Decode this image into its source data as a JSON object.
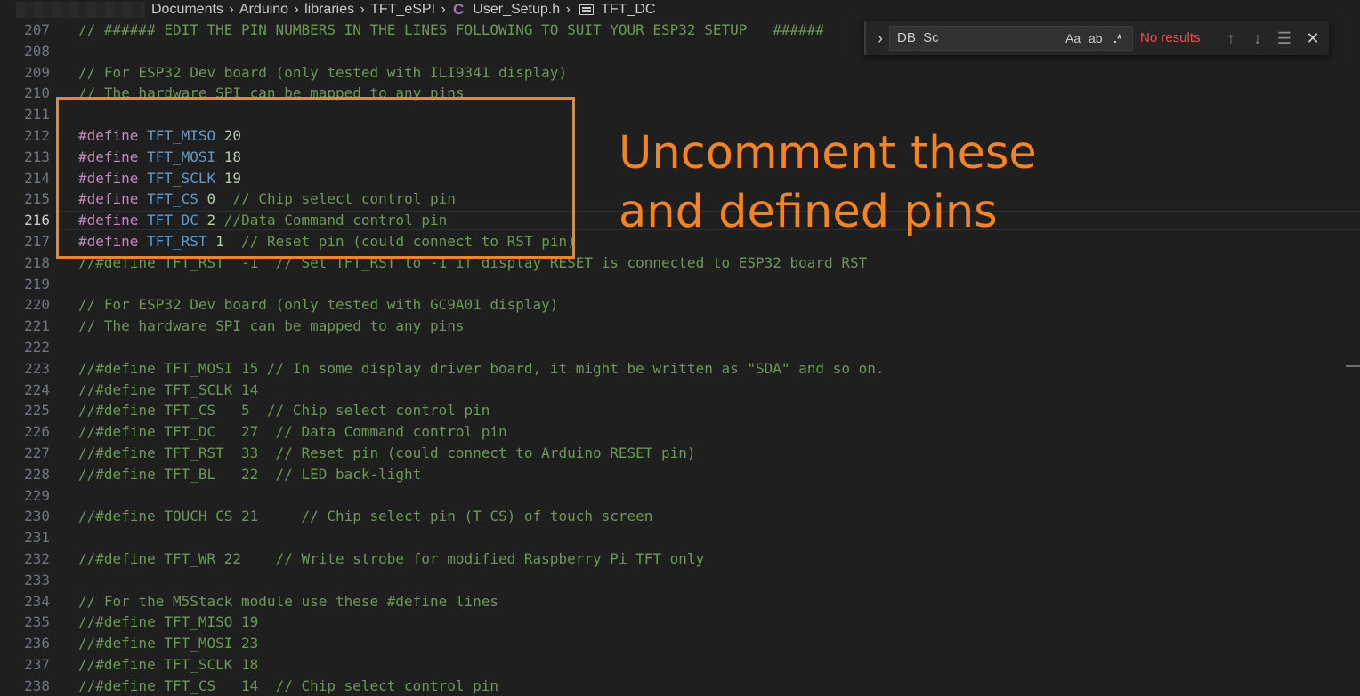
{
  "breadcrumb": {
    "items": [
      "Documents",
      "Arduino",
      "libraries",
      "TFT_eSPI",
      "User_Setup.h",
      "TFT_DC"
    ],
    "file_icon": "C"
  },
  "find": {
    "query": "DB_Sc",
    "match_case": "Aa",
    "whole_word": "ab",
    "regex": ".*",
    "status": "No results"
  },
  "annotation": {
    "line1": "Uncomment these",
    "line2": "and defined pins",
    "color": "#f5841f"
  },
  "editor": {
    "active_line": 216,
    "lines": [
      {
        "n": "207",
        "tokens": [
          {
            "t": "cm",
            "v": "// ###### EDIT THE PIN NUMBERS IN THE LINES FOLLOWING TO SUIT YOUR ESP32 SETUP   ######"
          }
        ]
      },
      {
        "n": "208",
        "tokens": []
      },
      {
        "n": "209",
        "tokens": [
          {
            "t": "cm",
            "v": "// For ESP32 Dev board (only tested with ILI9341 display)"
          }
        ]
      },
      {
        "n": "210",
        "tokens": [
          {
            "t": "cm",
            "v": "// The hardware SPI can be mapped to any pins"
          }
        ]
      },
      {
        "n": "211",
        "tokens": []
      },
      {
        "n": "212",
        "tokens": [
          {
            "t": "kw",
            "v": "#define"
          },
          {
            "t": "tx",
            "v": " "
          },
          {
            "t": "mac",
            "v": "TFT_MISO"
          },
          {
            "t": "tx",
            "v": " "
          },
          {
            "t": "num",
            "v": "20"
          }
        ]
      },
      {
        "n": "213",
        "tokens": [
          {
            "t": "kw",
            "v": "#define"
          },
          {
            "t": "tx",
            "v": " "
          },
          {
            "t": "mac",
            "v": "TFT_MOSI"
          },
          {
            "t": "tx",
            "v": " "
          },
          {
            "t": "num",
            "v": "18"
          }
        ]
      },
      {
        "n": "214",
        "tokens": [
          {
            "t": "kw",
            "v": "#define"
          },
          {
            "t": "tx",
            "v": " "
          },
          {
            "t": "mac",
            "v": "TFT_SCLK"
          },
          {
            "t": "tx",
            "v": " "
          },
          {
            "t": "num",
            "v": "19"
          }
        ]
      },
      {
        "n": "215",
        "tokens": [
          {
            "t": "kw",
            "v": "#define"
          },
          {
            "t": "tx",
            "v": " "
          },
          {
            "t": "mac",
            "v": "TFT_CS"
          },
          {
            "t": "tx",
            "v": " "
          },
          {
            "t": "num",
            "v": "0"
          },
          {
            "t": "tx",
            "v": "  "
          },
          {
            "t": "cm",
            "v": "// Chip select control pin"
          }
        ]
      },
      {
        "n": "216",
        "tokens": [
          {
            "t": "kw",
            "v": "#define"
          },
          {
            "t": "tx",
            "v": " "
          },
          {
            "t": "mac",
            "v": "TFT_DC"
          },
          {
            "t": "tx",
            "v": " "
          },
          {
            "t": "num",
            "v": "2"
          },
          {
            "t": "tx",
            "v": " "
          },
          {
            "t": "cm",
            "v": "//Data Command control pin"
          }
        ]
      },
      {
        "n": "217",
        "tokens": [
          {
            "t": "kw",
            "v": "#define"
          },
          {
            "t": "tx",
            "v": " "
          },
          {
            "t": "mac",
            "v": "TFT_RST"
          },
          {
            "t": "tx",
            "v": " "
          },
          {
            "t": "num",
            "v": "1"
          },
          {
            "t": "tx",
            "v": "  "
          },
          {
            "t": "cm",
            "v": "// Reset pin (could connect to RST pin)"
          }
        ]
      },
      {
        "n": "218",
        "tokens": [
          {
            "t": "cm",
            "v": "//#define TFT_RST  -1  // Set TFT_RST to -1 if display RESET is connected to ESP32 board RST"
          }
        ]
      },
      {
        "n": "219",
        "tokens": []
      },
      {
        "n": "220",
        "tokens": [
          {
            "t": "cm",
            "v": "// For ESP32 Dev board (only tested with GC9A01 display)"
          }
        ]
      },
      {
        "n": "221",
        "tokens": [
          {
            "t": "cm",
            "v": "// The hardware SPI can be mapped to any pins"
          }
        ]
      },
      {
        "n": "222",
        "tokens": []
      },
      {
        "n": "223",
        "tokens": [
          {
            "t": "cm",
            "v": "//#define TFT_MOSI 15 // In some display driver board, it might be written as \"SDA\" and so on."
          }
        ]
      },
      {
        "n": "224",
        "tokens": [
          {
            "t": "cm",
            "v": "//#define TFT_SCLK 14"
          }
        ]
      },
      {
        "n": "225",
        "tokens": [
          {
            "t": "cm",
            "v": "//#define TFT_CS   5  // Chip select control pin"
          }
        ]
      },
      {
        "n": "226",
        "tokens": [
          {
            "t": "cm",
            "v": "//#define TFT_DC   27  // Data Command control pin"
          }
        ]
      },
      {
        "n": "227",
        "tokens": [
          {
            "t": "cm",
            "v": "//#define TFT_RST  33  // Reset pin (could connect to Arduino RESET pin)"
          }
        ]
      },
      {
        "n": "228",
        "tokens": [
          {
            "t": "cm",
            "v": "//#define TFT_BL   22  // LED back-light"
          }
        ]
      },
      {
        "n": "229",
        "tokens": []
      },
      {
        "n": "230",
        "tokens": [
          {
            "t": "cm",
            "v": "//#define TOUCH_CS 21     // Chip select pin (T_CS) of touch screen"
          }
        ]
      },
      {
        "n": "231",
        "tokens": []
      },
      {
        "n": "232",
        "tokens": [
          {
            "t": "cm",
            "v": "//#define TFT_WR 22    // Write strobe for modified Raspberry Pi TFT only"
          }
        ]
      },
      {
        "n": "233",
        "tokens": []
      },
      {
        "n": "234",
        "tokens": [
          {
            "t": "cm",
            "v": "// For the M5Stack module use these #define lines"
          }
        ]
      },
      {
        "n": "235",
        "tokens": [
          {
            "t": "cm",
            "v": "//#define TFT_MISO 19"
          }
        ]
      },
      {
        "n": "236",
        "tokens": [
          {
            "t": "cm",
            "v": "//#define TFT_MOSI 23"
          }
        ]
      },
      {
        "n": "237",
        "tokens": [
          {
            "t": "cm",
            "v": "//#define TFT_SCLK 18"
          }
        ]
      },
      {
        "n": "238",
        "tokens": [
          {
            "t": "cm",
            "v": "//#define TFT_CS   14  // Chip select control pin"
          }
        ]
      }
    ]
  }
}
